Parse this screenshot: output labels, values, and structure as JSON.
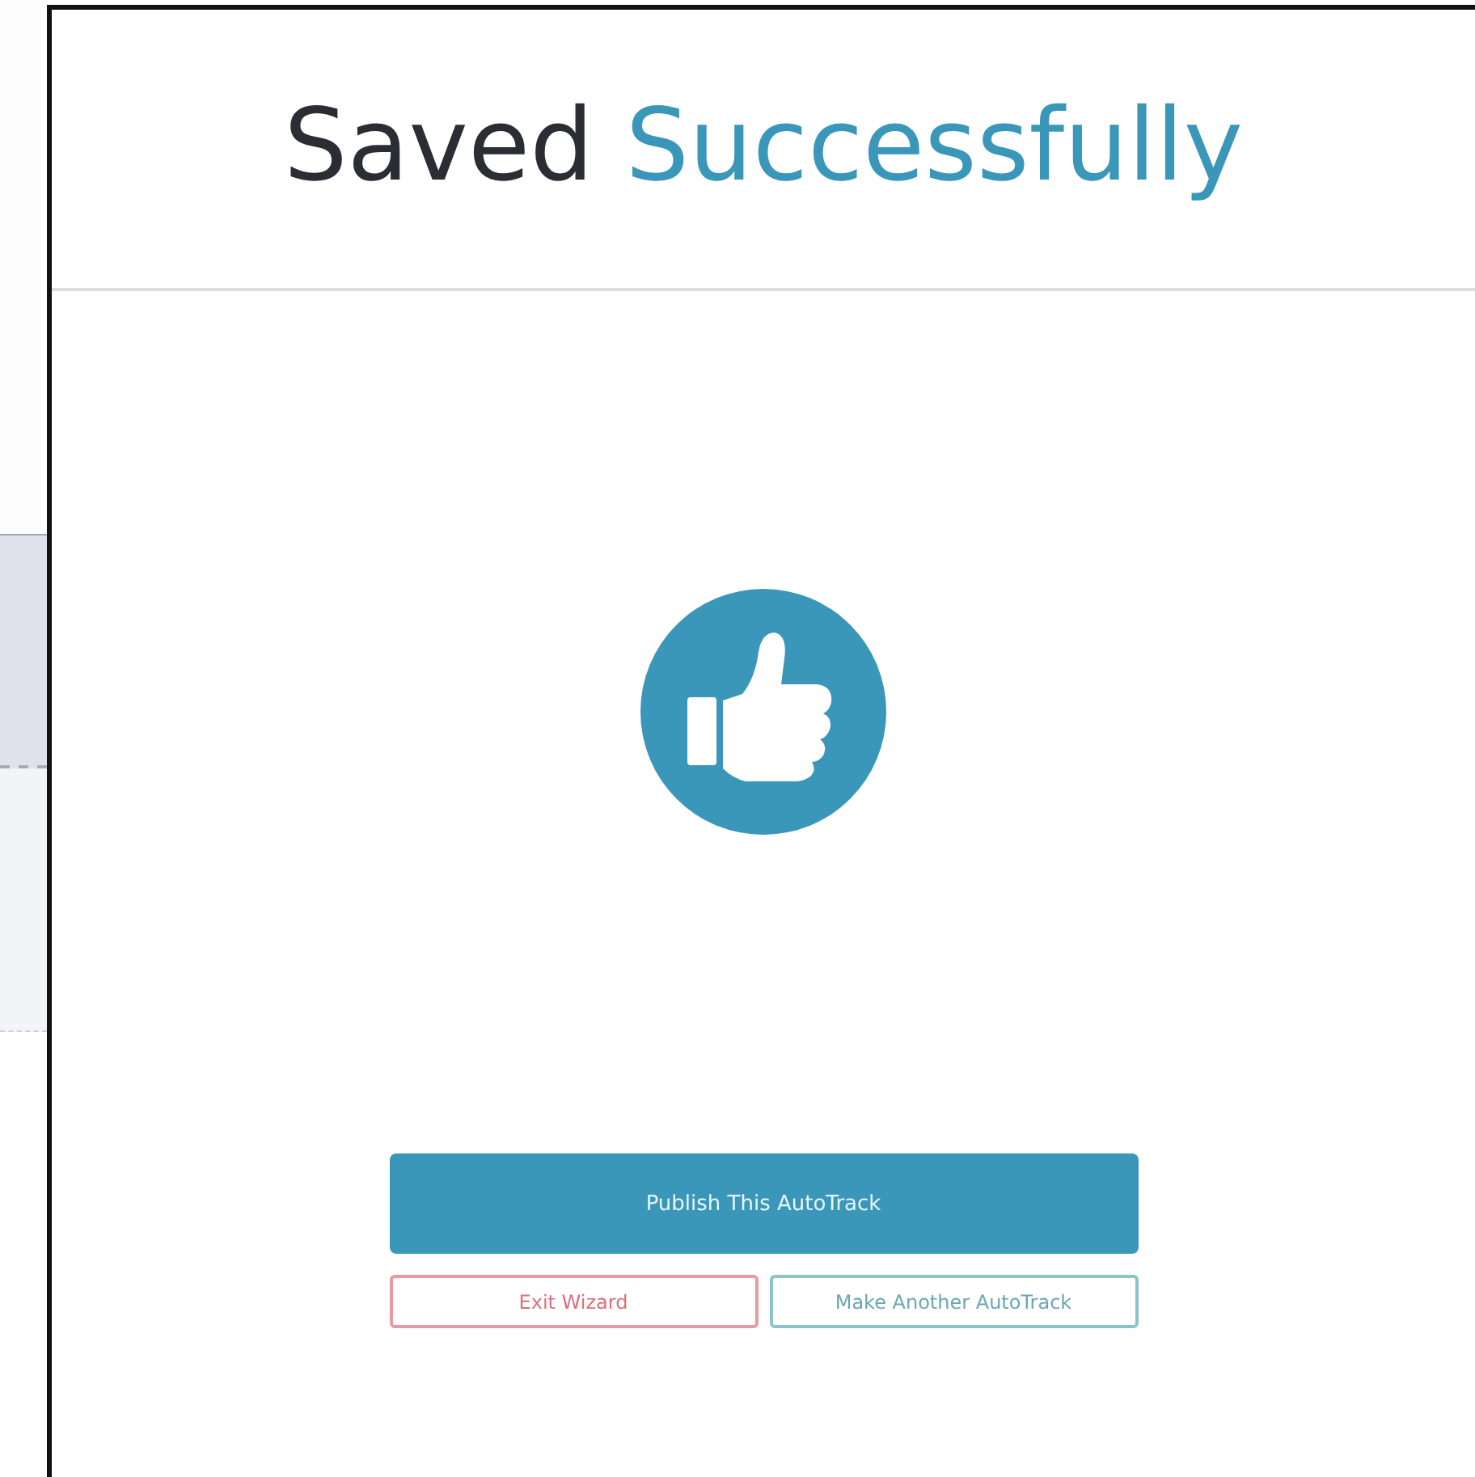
{
  "dialog": {
    "title": {
      "lead": "Saved",
      "accent": "Successfully"
    },
    "primary_button": "Publish This AutoTrack",
    "buttons": [
      {
        "label": "Exit Wizard",
        "kind": "danger"
      },
      {
        "label": "Make Another AutoTrack",
        "kind": "info"
      }
    ]
  }
}
